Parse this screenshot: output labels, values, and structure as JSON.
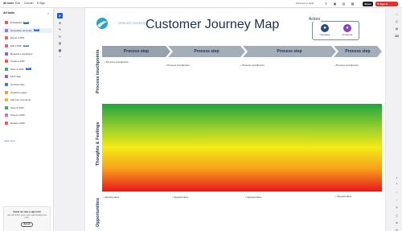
{
  "topbar": {
    "menu": [
      "All tools",
      "Edit",
      "Convert",
      "E-Sign"
    ],
    "find_text": "Find text or tools",
    "share_label": "Share",
    "signin_label": "Sign in",
    "signin_icon": "document-sign-icon"
  },
  "left_panel": {
    "title": "All tools",
    "tools": [
      {
        "label": "Embedded",
        "new": "NEW",
        "color": "#e35b5b"
      },
      {
        "label": "Generative summary",
        "new": "NEW",
        "color": "#a56be0"
      },
      {
        "label": "Export a PDF",
        "new": "",
        "color": "#e36464"
      },
      {
        "label": "Edit a PDF",
        "new": "NEW",
        "color": "#e8607a"
      },
      {
        "label": "Request e-signatures",
        "new": "",
        "color": "#9b59d8"
      },
      {
        "label": "Create a PDF",
        "new": "",
        "color": "#e35b5b"
      },
      {
        "label": "Scan & OCR",
        "new": "NEW",
        "color": "#3fa86c"
      },
      {
        "label": "Fill & Sign",
        "new": "",
        "color": "#9b59d8"
      },
      {
        "label": "Combine files",
        "new": "",
        "color": "#3f78d8"
      },
      {
        "label": "Organize pages",
        "new": "",
        "color": "#e3a340"
      },
      {
        "label": "Add free comments",
        "new": "",
        "color": "#e0b834"
      },
      {
        "label": "Scan & OCR",
        "new": "",
        "color": "#3fa86c"
      },
      {
        "label": "Protect a PDF",
        "new": "",
        "color": "#d66ad4"
      },
      {
        "label": "Redact a PDF",
        "new": "",
        "color": "#e35b5b"
      }
    ],
    "view_more": "View more",
    "promo": {
      "title": "Check out new e-sign tools",
      "text": "Use web forms, send e-sign, add branding, and more.",
      "button": "See all"
    }
  },
  "vertical_tools": [
    "cursor-icon",
    "zoom-icon",
    "pen-icon",
    "rotate-icon",
    "text-box-icon",
    "stamp-icon",
    "more-icon"
  ],
  "document": {
    "logo_text": "VentureConsulting",
    "title": "Customer Journey Map",
    "actors_label": "Actors",
    "actors": [
      {
        "label": "Company",
        "color": "#2a4a80"
      },
      {
        "label": "Customer",
        "color": "#8b3fc4"
      }
    ],
    "row_labels": {
      "touchpoints": "Process touchpoints",
      "thoughts": "Thoughts & Feelings",
      "opportunities": "Opportunities"
    },
    "steps": [
      "Process step",
      "Process step",
      "Process step",
      "Process step"
    ],
    "touchpoints": [
      "Process touchpoints",
      "Process touchpoints",
      "Process touchpoints",
      "Process touchpoints"
    ],
    "opportunities": [
      "Opportunities",
      "Opportunities",
      "Opportunities",
      "Opportunities"
    ],
    "gradient_colors": [
      "#1fa53f",
      "#f6ea16",
      "#e8161b"
    ]
  },
  "right_rail": {
    "page_current": "1",
    "page_total": "1"
  }
}
